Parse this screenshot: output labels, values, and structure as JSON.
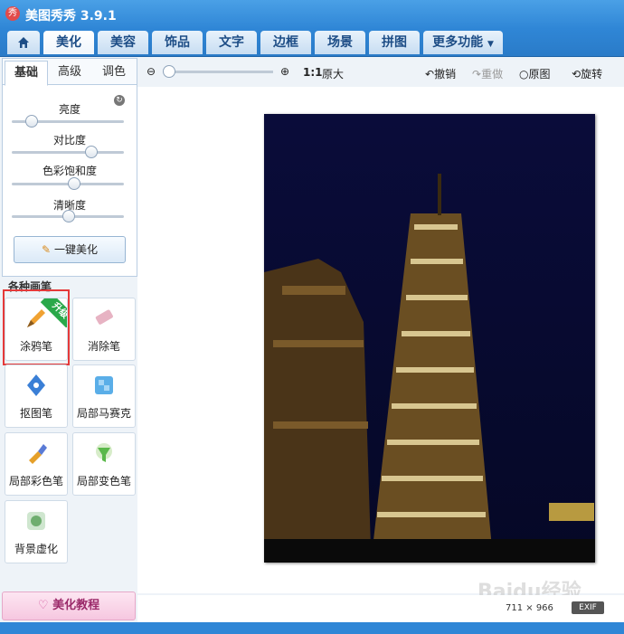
{
  "window": {
    "title": "美图秀秀 3.9.1",
    "icon": "秀"
  },
  "tabs": [
    "美化",
    "美容",
    "饰品",
    "文字",
    "边框",
    "场景",
    "拼图",
    "更多功能"
  ],
  "subtabs": [
    "基础",
    "高级",
    "调色"
  ],
  "sliders": [
    {
      "label": "亮度",
      "value": 0.18
    },
    {
      "label": "对比度",
      "value": 0.7
    },
    {
      "label": "色彩饱和度",
      "value": 0.56
    },
    {
      "label": "清晰度",
      "value": 0.5
    }
  ],
  "onekey_label": "一键美化",
  "section_label": "各种画笔",
  "tools": [
    "涂鸦笔",
    "消除笔",
    "抠图笔",
    "局部马赛克",
    "局部彩色笔",
    "局部变色笔",
    "背景虚化"
  ],
  "upgrade_badge": "升级",
  "tutorial_label": "美化教程",
  "toolbar": {
    "zoom_ratio": "1:1",
    "original_size": "原大",
    "undo": "撤销",
    "redo": "重做",
    "original": "原图",
    "rotate": "旋转"
  },
  "status": {
    "size": "711 × 966",
    "exif": "EXIF"
  },
  "watermark": "Baidu经验",
  "colors": {
    "accent": "#2f86d6",
    "highlight": "#e53939",
    "badge": "#2aa84a"
  }
}
